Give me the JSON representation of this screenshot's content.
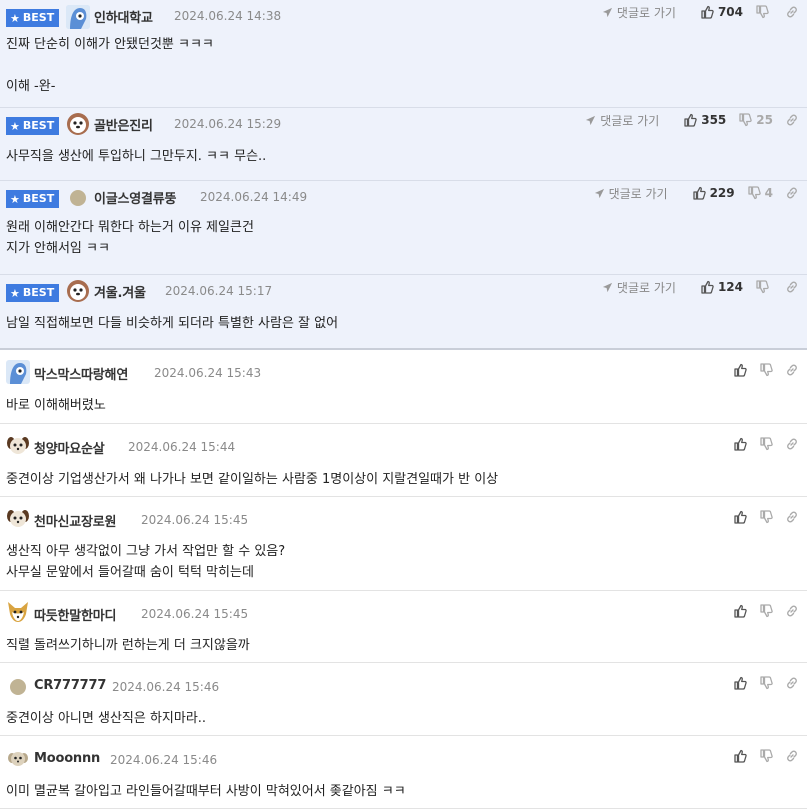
{
  "labels": {
    "best": "BEST",
    "reply_link": "댓글로 가기"
  },
  "colors": {
    "best_badge": "#3e7be0",
    "best_bg": "#eef2fb"
  },
  "comments": [
    {
      "nick": "인하대학교",
      "date": "2024.06.24 14:38",
      "likes": "704",
      "dislikes": "",
      "avatar": "blue-character-avatar",
      "text": "진짜 단순히 이해가 안됐던것뿐 ㅋㅋㅋ\n\n이해 -완-"
    },
    {
      "nick": "골반은진리",
      "date": "2024.06.24 15:29",
      "likes": "355",
      "dislikes": "25",
      "avatar": "panda-avatar",
      "text": "사무직을 생산에 투입하니 그만두지. ㅋㅋ 무슨.."
    },
    {
      "nick": "이글스영결류뚱",
      "date": "2024.06.24 14:49",
      "likes": "229",
      "dislikes": "4",
      "avatar": "dot-avatar",
      "text": "원래 이해안간다 뭐한다 하는거 이유 제일큰건\n지가 안해서임 ㅋㅋ"
    },
    {
      "nick": "겨울.겨울",
      "date": "2024.06.24 15:17",
      "likes": "124",
      "dislikes": "",
      "avatar": "panda-avatar",
      "text": "남일 직접해보면 다들 비슷하게 되더라 특별한 사람은 잘 없어"
    },
    {
      "nick": "막스막스따랑해연",
      "date": "2024.06.24 15:43",
      "avatar": "blue-character-avatar",
      "text": "바로 이해해버렸노"
    },
    {
      "nick": "청양마요순살",
      "date": "2024.06.24 15:44",
      "avatar": "puppy-avatar",
      "text": "중견이상 기업생산가서 왜 나가나 보면 같이일하는 사람중 1명이상이 지랄견일때가 반 이상"
    },
    {
      "nick": "천마신교장로원",
      "date": "2024.06.24 15:45",
      "avatar": "puppy-avatar",
      "text": "생산직 아무 생각없이 그냥 가서 작업만 할 수 있음?\n사무실 문앞에서 들어갈때 숨이 턱턱 막히는데"
    },
    {
      "nick": "따듯한말한마디",
      "date": "2024.06.24 15:45",
      "avatar": "fox-avatar",
      "text": "직렬 돌려쓰기하니까 런하는게 더 크지않을까"
    },
    {
      "nick": "CR777777",
      "date": "2024.06.24 15:46",
      "avatar": "dot-avatar",
      "text": "중견이상 아니면 생산직은 하지마라.."
    },
    {
      "nick": "Mooonnn",
      "date": "2024.06.24 15:46",
      "avatar": "small-puppy-avatar",
      "text": "이미 멸균복 갈아입고 라인들어갈때부터 사방이 막혀있어서 좆같아짐 ㅋㅋ"
    }
  ]
}
